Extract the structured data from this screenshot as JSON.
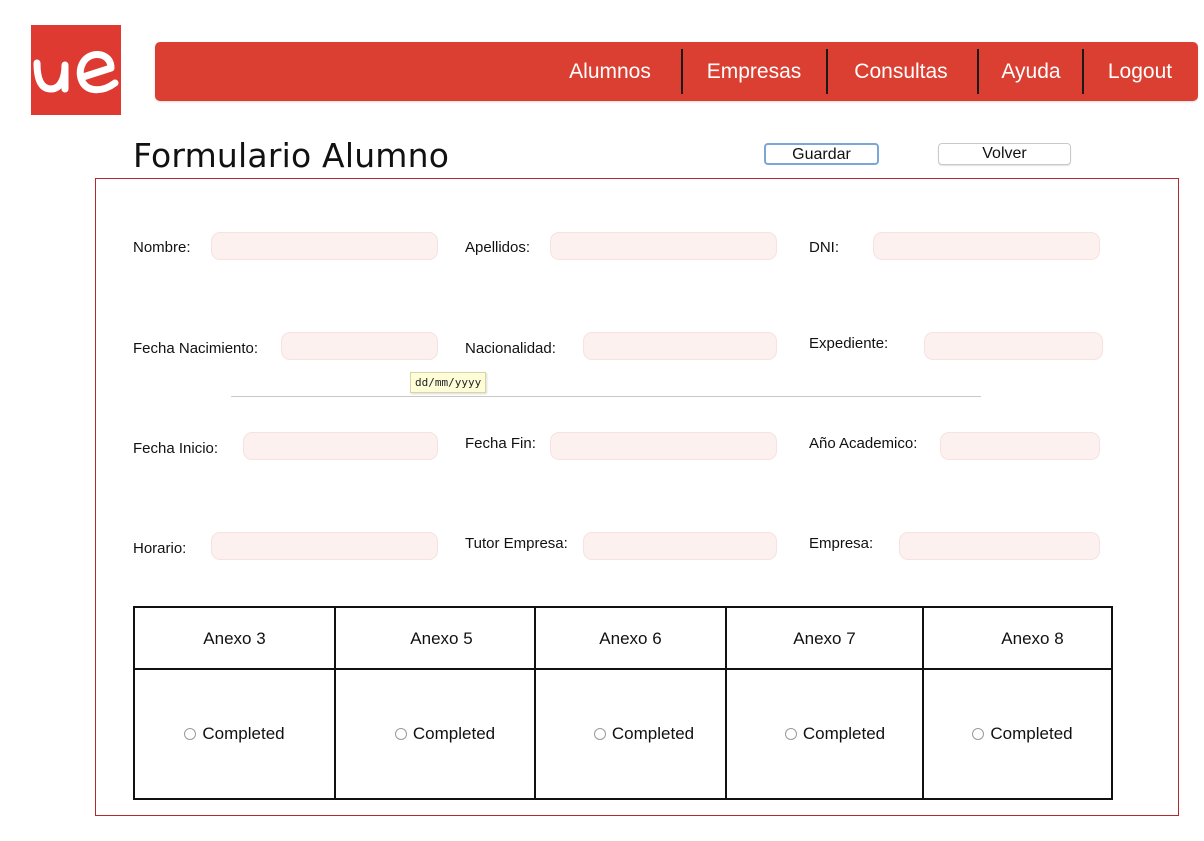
{
  "brand": {
    "logo_text": "ue",
    "color": "#de3a31"
  },
  "nav": {
    "items": [
      "Alumnos",
      "Empresas",
      "Consultas",
      "Ayuda",
      "Logout"
    ]
  },
  "page": {
    "title": "Formulario Alumno"
  },
  "actions": {
    "save_label": "Guardar",
    "back_label": "Volver"
  },
  "form": {
    "fields": {
      "nombre": {
        "label": "Nombre:",
        "value": ""
      },
      "apellidos": {
        "label": "Apellidos:",
        "value": ""
      },
      "dni": {
        "label": "DNI:",
        "value": ""
      },
      "fecha_nacimiento": {
        "label": "Fecha Nacimiento:",
        "value": ""
      },
      "nacionalidad": {
        "label": "Nacionalidad:",
        "value": ""
      },
      "expediente": {
        "label": "Expediente:",
        "value": ""
      },
      "fecha_inicio": {
        "label": "Fecha Inicio:",
        "value": ""
      },
      "fecha_fin": {
        "label": "Fecha Fin:",
        "value": ""
      },
      "anio_academico": {
        "label": "Año Academico:",
        "value": ""
      },
      "horario": {
        "label": "Horario:",
        "value": ""
      },
      "tutor_empresa": {
        "label": "Tutor Empresa:",
        "value": ""
      },
      "empresa": {
        "label": "Empresa:",
        "value": ""
      }
    },
    "date_tooltip": "dd/mm/yyyy"
  },
  "annexes": {
    "headers": [
      "Anexo 3",
      "Anexo 5",
      "Anexo 6",
      "Anexo 7",
      "Anexo 8"
    ],
    "option_label": "Completed"
  }
}
